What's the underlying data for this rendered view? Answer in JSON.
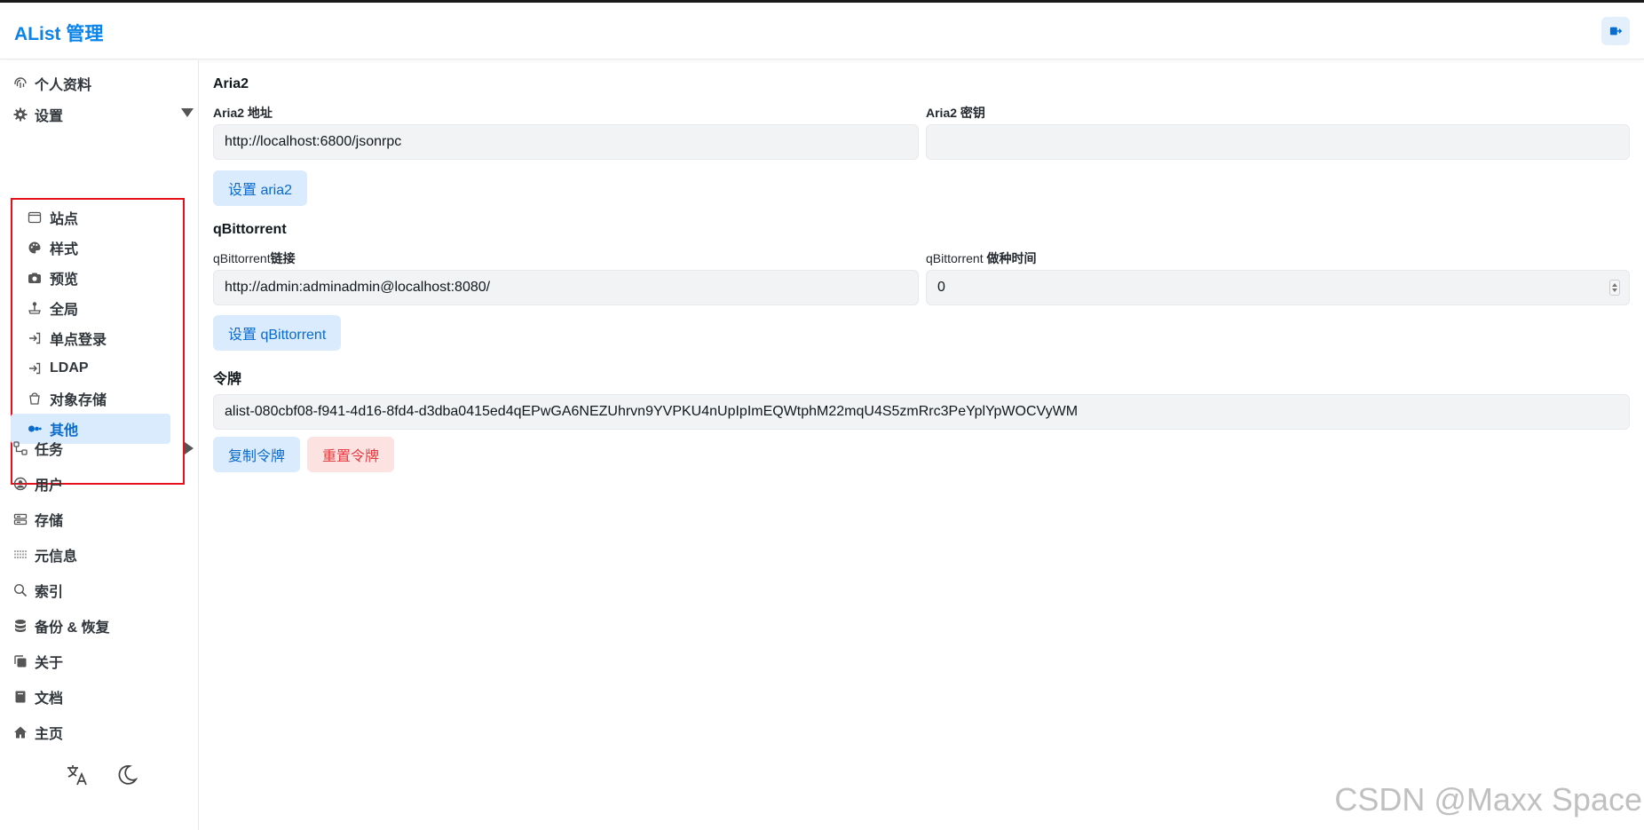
{
  "app": {
    "title": "AList 管理"
  },
  "sidebar": {
    "items": [
      {
        "label": "个人资料",
        "icon": "fingerprint-icon"
      },
      {
        "label": "设置",
        "icon": "gear-icon"
      },
      {
        "label": "任务",
        "icon": "flow-icon"
      },
      {
        "label": "用户",
        "icon": "user-circle-icon"
      },
      {
        "label": "存储",
        "icon": "storage-icon"
      },
      {
        "label": "元信息",
        "icon": "metadata-icon"
      },
      {
        "label": "索引",
        "icon": "search-icon"
      },
      {
        "label": "备份 & 恢复",
        "icon": "database-icon"
      },
      {
        "label": "关于",
        "icon": "copy-icon"
      },
      {
        "label": "文档",
        "icon": "book-icon"
      },
      {
        "label": "主页",
        "icon": "home-icon"
      }
    ],
    "settings_sub": [
      {
        "label": "站点",
        "icon": "window-icon"
      },
      {
        "label": "样式",
        "icon": "palette-icon"
      },
      {
        "label": "预览",
        "icon": "camera-icon"
      },
      {
        "label": "全局",
        "icon": "joystick-icon"
      },
      {
        "label": "单点登录",
        "icon": "login-icon"
      },
      {
        "label": "LDAP",
        "icon": "login-icon"
      },
      {
        "label": "对象存储",
        "icon": "bucket-icon"
      },
      {
        "label": "其他",
        "icon": "dots-icon"
      }
    ],
    "active_sub": "其他"
  },
  "main": {
    "aria2": {
      "title": "Aria2",
      "url_label": "Aria2 地址",
      "url_value": "http://localhost:6800/jsonrpc",
      "secret_label": "Aria2 密钥",
      "secret_value": "",
      "button": "设置 aria2"
    },
    "qbit": {
      "title": "qBittorrent",
      "url_label_prefix": "qBittorrent",
      "url_label_suffix": "链接",
      "url_value": "http://admin:adminadmin@localhost:8080/",
      "seed_label_prefix": "qBittorrent ",
      "seed_label_suffix": "做种时间",
      "seed_value": "0",
      "button": "设置 qBittorrent"
    },
    "token": {
      "title": "令牌",
      "value": "alist-080cbf08-f941-4d16-8fd4-d3dba0415ed4qEPwGA6NEZUhrvn9YVPKU4nUpIpImEQWtphM22mqU4S5zmRrc3PeYplYpWOCVyWM",
      "copy_button": "复制令牌",
      "reset_button": "重置令牌"
    }
  },
  "watermark": "CSDN @Maxx Space",
  "colors": {
    "accent": "#0b84ea",
    "active_bg": "#d9ebfc",
    "danger": "#e5393f",
    "highlight_box": "#e5101a"
  }
}
